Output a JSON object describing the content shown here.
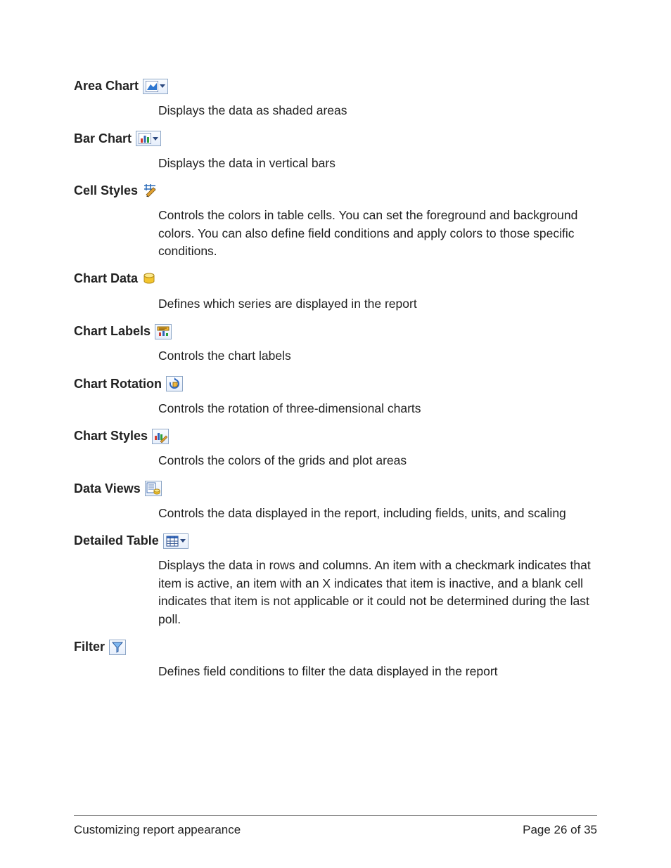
{
  "entries": [
    {
      "term": "Area Chart",
      "desc": "Displays the data as shaded areas"
    },
    {
      "term": "Bar Chart",
      "desc": "Displays the data in vertical bars"
    },
    {
      "term": "Cell Styles",
      "desc": "Controls the colors in table cells. You can set the foreground and background colors. You can also define field conditions and apply colors to those specific conditions."
    },
    {
      "term": "Chart Data",
      "desc": "Defines which series are displayed in the report"
    },
    {
      "term": "Chart Labels",
      "desc": "Controls the chart labels"
    },
    {
      "term": "Chart Rotation",
      "desc": "Controls the rotation of three-dimensional charts"
    },
    {
      "term": "Chart Styles",
      "desc": "Controls the colors of the grids and plot areas"
    },
    {
      "term": "Data Views",
      "desc": "Controls the data displayed in the report, including fields, units, and scaling"
    },
    {
      "term": "Detailed Table",
      "desc": "Displays the data in rows and columns. An item with a checkmark indicates that item is active, an item with an X indicates that item is inactive, and a blank cell indicates that item is not applicable or it could not be determined during the last poll."
    },
    {
      "term": "Filter",
      "desc": "Defines field conditions to filter the data displayed in the report"
    }
  ],
  "footer": {
    "left": "Customizing report appearance",
    "right": "Page 26 of 35"
  }
}
